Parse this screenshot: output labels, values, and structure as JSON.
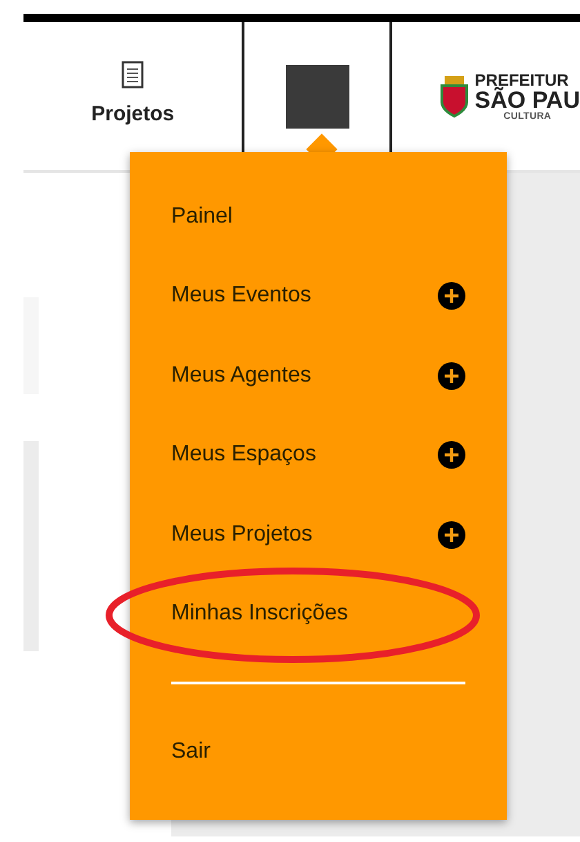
{
  "header": {
    "nav": [
      {
        "kind": "projects",
        "label": "Projetos"
      },
      {
        "kind": "avatar"
      }
    ],
    "logo": {
      "line_1": "PREFEITUR",
      "line_2": "SÃO PAU",
      "line_3": "CULTURA"
    }
  },
  "menu": {
    "items": [
      {
        "kind": "link",
        "label": "Painel",
        "circled": false
      },
      {
        "kind": "add",
        "label": "Meus Eventos",
        "circled": false
      },
      {
        "kind": "add",
        "label": "Meus Agentes",
        "circled": false
      },
      {
        "kind": "add",
        "label": "Meus Espaços",
        "circled": false
      },
      {
        "kind": "add",
        "label": "Meus Projetos",
        "circled": false
      },
      {
        "kind": "link",
        "label": "Minhas Inscrições",
        "circled": true
      },
      {
        "kind": "divider"
      },
      {
        "kind": "link",
        "label": "Sair",
        "circled": false
      }
    ]
  }
}
